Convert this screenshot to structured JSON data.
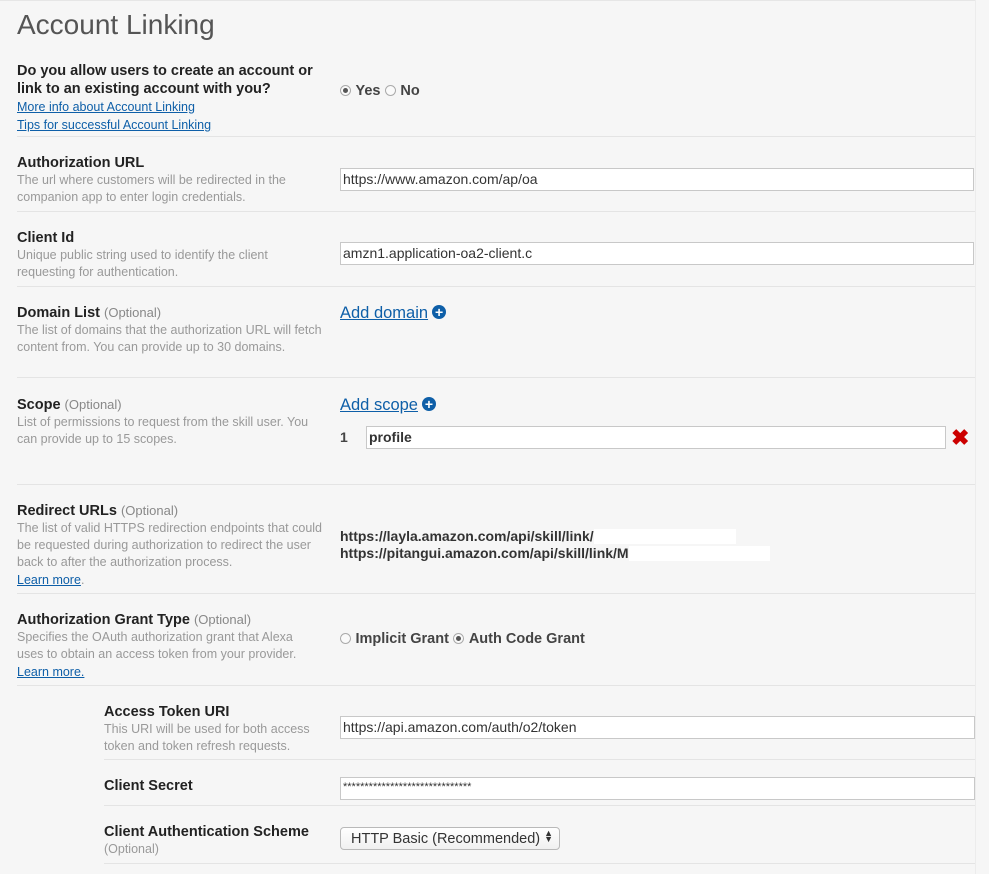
{
  "page_title": "Account Linking",
  "account_linking": {
    "question": "Do you allow users to create an account or link to an existing account with you?",
    "more_info_link": "More info about Account Linking",
    "tips_link": "Tips for successful Account Linking",
    "yes_label": "Yes",
    "no_label": "No",
    "selected": "Yes"
  },
  "authorization_url": {
    "title": "Authorization URL",
    "description": "The url where customers will be redirected in the companion app to enter login credentials.",
    "value": "https://www.amazon.com/ap/oa"
  },
  "client_id": {
    "title": "Client Id",
    "description": "Unique public string used to identify the client requesting for authentication.",
    "value": "amzn1.application-oa2-client.c"
  },
  "domain_list": {
    "title": "Domain List",
    "optional": "(Optional)",
    "description": "The list of domains that the authorization URL will fetch content from. You can provide up to 30 domains.",
    "add_label": "Add domain"
  },
  "scope": {
    "title": "Scope",
    "optional": "(Optional)",
    "description": "List of permissions to request from the skill user. You can provide up to 15 scopes.",
    "add_label": "Add scope",
    "items": [
      {
        "index": "1",
        "value": "profile"
      }
    ]
  },
  "redirect_urls": {
    "title": "Redirect URLs",
    "optional": "(Optional)",
    "description": "The list of valid HTTPS redirection endpoints that could be requested during authorization to redirect the user back to after the authorization process.",
    "learn_more": "Learn more",
    "learn_more_suffix": ".",
    "urls": [
      "https://layla.amazon.com/api/skill/link/",
      "https://pitangui.amazon.com/api/skill/link/M"
    ]
  },
  "grant_type": {
    "title": "Authorization Grant Type",
    "optional": "(Optional)",
    "description": "Specifies the OAuth authorization grant that Alexa uses to obtain an access token from your provider.",
    "learn_more": "Learn more.",
    "implicit_label": "Implicit Grant",
    "auth_code_label": "Auth Code Grant",
    "selected": "Auth Code Grant"
  },
  "access_token_uri": {
    "title": "Access Token URI",
    "description": "This URI will be used for both access token and token refresh requests.",
    "value": "https://api.amazon.com/auth/o2/token"
  },
  "client_secret": {
    "title": "Client Secret",
    "value": "******************************"
  },
  "client_auth_scheme": {
    "title": "Client Authentication Scheme",
    "optional": "(Optional)",
    "selected": "HTTP Basic (Recommended)"
  },
  "icons": {
    "add": "plus-circle-icon",
    "delete": "red-x-icon",
    "select_arrows": "up-down-arrows-icon"
  },
  "colors": {
    "link": "#0e5fa8",
    "delete": "#cc0000"
  }
}
